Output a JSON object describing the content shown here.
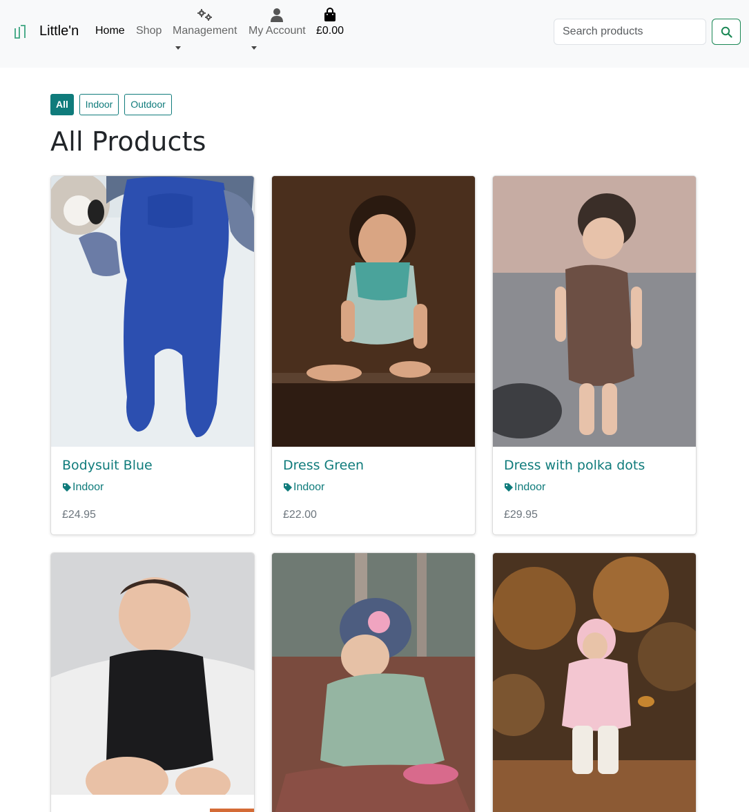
{
  "brand": {
    "name": "Little'n",
    "accent": "#0f7b7b"
  },
  "nav": {
    "home": "Home",
    "shop": "Shop",
    "management": "Management",
    "account": "My Account",
    "bag_total": "£0.00"
  },
  "search": {
    "placeholder": "Search products",
    "button_color": "#198754"
  },
  "filters": [
    {
      "label": "All",
      "active": true
    },
    {
      "label": "Indoor",
      "active": false
    },
    {
      "label": "Outdoor",
      "active": false
    }
  ],
  "page_title": "All Products",
  "products": [
    {
      "name": "Bodysuit Blue",
      "category": "Indoor",
      "price": "£24.95"
    },
    {
      "name": "Dress Green",
      "category": "Indoor",
      "price": "£22.00"
    },
    {
      "name": "Dress with polka dots",
      "category": "Indoor",
      "price": "£29.95"
    },
    {
      "name": "",
      "category": "",
      "price": ""
    },
    {
      "name": "",
      "category": "",
      "price": ""
    },
    {
      "name": "",
      "category": "",
      "price": ""
    }
  ]
}
